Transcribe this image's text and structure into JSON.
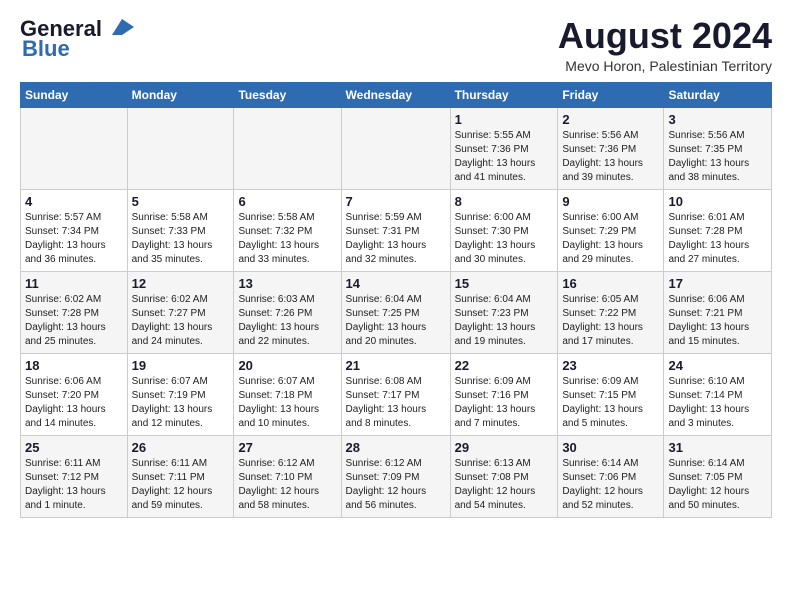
{
  "header": {
    "logo_line1": "General",
    "logo_line2": "Blue",
    "month_title": "August 2024",
    "subtitle": "Mevo Horon, Palestinian Territory"
  },
  "days_of_week": [
    "Sunday",
    "Monday",
    "Tuesday",
    "Wednesday",
    "Thursday",
    "Friday",
    "Saturday"
  ],
  "weeks": [
    [
      {
        "num": "",
        "sunrise": "",
        "sunset": "",
        "daylight": ""
      },
      {
        "num": "",
        "sunrise": "",
        "sunset": "",
        "daylight": ""
      },
      {
        "num": "",
        "sunrise": "",
        "sunset": "",
        "daylight": ""
      },
      {
        "num": "",
        "sunrise": "",
        "sunset": "",
        "daylight": ""
      },
      {
        "num": "1",
        "sunrise": "Sunrise: 5:55 AM",
        "sunset": "Sunset: 7:36 PM",
        "daylight": "Daylight: 13 hours and 41 minutes."
      },
      {
        "num": "2",
        "sunrise": "Sunrise: 5:56 AM",
        "sunset": "Sunset: 7:36 PM",
        "daylight": "Daylight: 13 hours and 39 minutes."
      },
      {
        "num": "3",
        "sunrise": "Sunrise: 5:56 AM",
        "sunset": "Sunset: 7:35 PM",
        "daylight": "Daylight: 13 hours and 38 minutes."
      }
    ],
    [
      {
        "num": "4",
        "sunrise": "Sunrise: 5:57 AM",
        "sunset": "Sunset: 7:34 PM",
        "daylight": "Daylight: 13 hours and 36 minutes."
      },
      {
        "num": "5",
        "sunrise": "Sunrise: 5:58 AM",
        "sunset": "Sunset: 7:33 PM",
        "daylight": "Daylight: 13 hours and 35 minutes."
      },
      {
        "num": "6",
        "sunrise": "Sunrise: 5:58 AM",
        "sunset": "Sunset: 7:32 PM",
        "daylight": "Daylight: 13 hours and 33 minutes."
      },
      {
        "num": "7",
        "sunrise": "Sunrise: 5:59 AM",
        "sunset": "Sunset: 7:31 PM",
        "daylight": "Daylight: 13 hours and 32 minutes."
      },
      {
        "num": "8",
        "sunrise": "Sunrise: 6:00 AM",
        "sunset": "Sunset: 7:30 PM",
        "daylight": "Daylight: 13 hours and 30 minutes."
      },
      {
        "num": "9",
        "sunrise": "Sunrise: 6:00 AM",
        "sunset": "Sunset: 7:29 PM",
        "daylight": "Daylight: 13 hours and 29 minutes."
      },
      {
        "num": "10",
        "sunrise": "Sunrise: 6:01 AM",
        "sunset": "Sunset: 7:28 PM",
        "daylight": "Daylight: 13 hours and 27 minutes."
      }
    ],
    [
      {
        "num": "11",
        "sunrise": "Sunrise: 6:02 AM",
        "sunset": "Sunset: 7:28 PM",
        "daylight": "Daylight: 13 hours and 25 minutes."
      },
      {
        "num": "12",
        "sunrise": "Sunrise: 6:02 AM",
        "sunset": "Sunset: 7:27 PM",
        "daylight": "Daylight: 13 hours and 24 minutes."
      },
      {
        "num": "13",
        "sunrise": "Sunrise: 6:03 AM",
        "sunset": "Sunset: 7:26 PM",
        "daylight": "Daylight: 13 hours and 22 minutes."
      },
      {
        "num": "14",
        "sunrise": "Sunrise: 6:04 AM",
        "sunset": "Sunset: 7:25 PM",
        "daylight": "Daylight: 13 hours and 20 minutes."
      },
      {
        "num": "15",
        "sunrise": "Sunrise: 6:04 AM",
        "sunset": "Sunset: 7:23 PM",
        "daylight": "Daylight: 13 hours and 19 minutes."
      },
      {
        "num": "16",
        "sunrise": "Sunrise: 6:05 AM",
        "sunset": "Sunset: 7:22 PM",
        "daylight": "Daylight: 13 hours and 17 minutes."
      },
      {
        "num": "17",
        "sunrise": "Sunrise: 6:06 AM",
        "sunset": "Sunset: 7:21 PM",
        "daylight": "Daylight: 13 hours and 15 minutes."
      }
    ],
    [
      {
        "num": "18",
        "sunrise": "Sunrise: 6:06 AM",
        "sunset": "Sunset: 7:20 PM",
        "daylight": "Daylight: 13 hours and 14 minutes."
      },
      {
        "num": "19",
        "sunrise": "Sunrise: 6:07 AM",
        "sunset": "Sunset: 7:19 PM",
        "daylight": "Daylight: 13 hours and 12 minutes."
      },
      {
        "num": "20",
        "sunrise": "Sunrise: 6:07 AM",
        "sunset": "Sunset: 7:18 PM",
        "daylight": "Daylight: 13 hours and 10 minutes."
      },
      {
        "num": "21",
        "sunrise": "Sunrise: 6:08 AM",
        "sunset": "Sunset: 7:17 PM",
        "daylight": "Daylight: 13 hours and 8 minutes."
      },
      {
        "num": "22",
        "sunrise": "Sunrise: 6:09 AM",
        "sunset": "Sunset: 7:16 PM",
        "daylight": "Daylight: 13 hours and 7 minutes."
      },
      {
        "num": "23",
        "sunrise": "Sunrise: 6:09 AM",
        "sunset": "Sunset: 7:15 PM",
        "daylight": "Daylight: 13 hours and 5 minutes."
      },
      {
        "num": "24",
        "sunrise": "Sunrise: 6:10 AM",
        "sunset": "Sunset: 7:14 PM",
        "daylight": "Daylight: 13 hours and 3 minutes."
      }
    ],
    [
      {
        "num": "25",
        "sunrise": "Sunrise: 6:11 AM",
        "sunset": "Sunset: 7:12 PM",
        "daylight": "Daylight: 13 hours and 1 minute."
      },
      {
        "num": "26",
        "sunrise": "Sunrise: 6:11 AM",
        "sunset": "Sunset: 7:11 PM",
        "daylight": "Daylight: 12 hours and 59 minutes."
      },
      {
        "num": "27",
        "sunrise": "Sunrise: 6:12 AM",
        "sunset": "Sunset: 7:10 PM",
        "daylight": "Daylight: 12 hours and 58 minutes."
      },
      {
        "num": "28",
        "sunrise": "Sunrise: 6:12 AM",
        "sunset": "Sunset: 7:09 PM",
        "daylight": "Daylight: 12 hours and 56 minutes."
      },
      {
        "num": "29",
        "sunrise": "Sunrise: 6:13 AM",
        "sunset": "Sunset: 7:08 PM",
        "daylight": "Daylight: 12 hours and 54 minutes."
      },
      {
        "num": "30",
        "sunrise": "Sunrise: 6:14 AM",
        "sunset": "Sunset: 7:06 PM",
        "daylight": "Daylight: 12 hours and 52 minutes."
      },
      {
        "num": "31",
        "sunrise": "Sunrise: 6:14 AM",
        "sunset": "Sunset: 7:05 PM",
        "daylight": "Daylight: 12 hours and 50 minutes."
      }
    ]
  ]
}
